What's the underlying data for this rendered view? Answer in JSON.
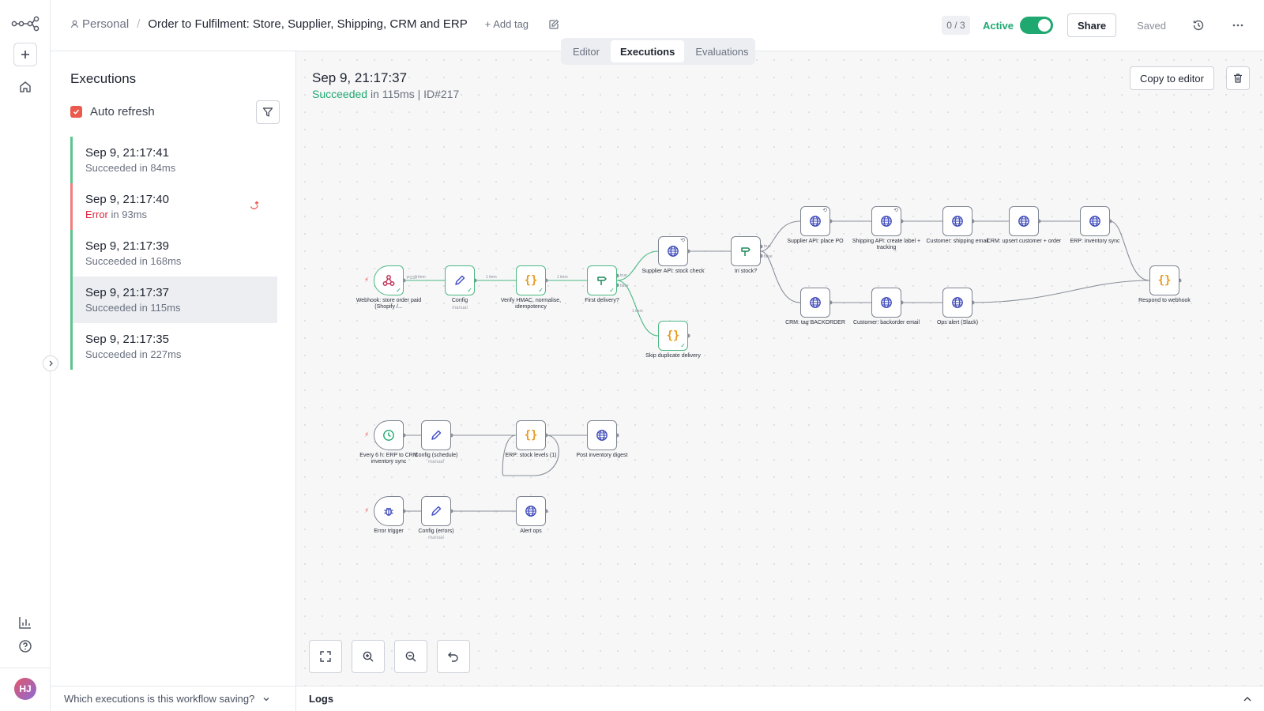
{
  "header": {
    "workspace": "Personal",
    "workflow_title": "Order to Fulfilment: Store, Supplier, Shipping, CRM and ERP",
    "add_tag": "+ Add tag",
    "counter": "0 / 3",
    "active_label": "Active",
    "share_label": "Share",
    "saved_label": "Saved"
  },
  "tabs": [
    "Editor",
    "Executions",
    "Evaluations"
  ],
  "executions": {
    "heading": "Executions",
    "auto_refresh_label": "Auto refresh",
    "items": [
      {
        "time": "Sep 9, 21:17:41",
        "state": "Succeeded",
        "duration": " in 84ms"
      },
      {
        "time": "Sep 9, 21:17:40",
        "state": "Error",
        "duration": " in 93ms"
      },
      {
        "time": "Sep 9, 21:17:39",
        "state": "Succeeded",
        "duration": " in 168ms"
      },
      {
        "time": "Sep 9, 21:17:37",
        "state": "Succeeded",
        "duration": " in 115ms"
      },
      {
        "time": "Sep 9, 21:17:35",
        "state": "Succeeded",
        "duration": " in 227ms"
      }
    ],
    "saving_question": "Which executions is this workflow saving?"
  },
  "run": {
    "time": "Sep 9, 21:17:37",
    "state": "Succeeded",
    "detail": " in 115ms | ID#217",
    "copy_label": "Copy to editor"
  },
  "nodes": {
    "webhook": "Webhook: store order paid (Shopify /...",
    "config": "Config",
    "config_sub": "manual",
    "verify": "Verify HMAC, normalise, idempotency",
    "first_delivery": "First delivery?",
    "supplier_stock": "Supplier API: stock check",
    "skip_dup": "Skip duplicate delivery",
    "in_stock": "In stock?",
    "supplier_po": "Supplier API: place PO",
    "shipping_label": "Shipping API: create label + tracking",
    "customer_shipping": "Customer: shipping email",
    "crm_upsert": "CRM: upsert customer + order",
    "erp_sync": "ERP: inventory sync",
    "respond": "Respond to webhook",
    "crm_backorder": "CRM: tag BACKORDER",
    "customer_backorder": "Customer: backorder email",
    "ops_alert": "Ops alert (Slack)",
    "every6h": "Every 6 h: ERP to CRM inventory sync",
    "config_schedule": "Config (schedule)",
    "config_schedule_sub": "manual",
    "erp_stock": "ERP: stock levels (1)",
    "post_digest": "Post inventory digest",
    "error_trigger": "Error trigger",
    "config_errors": "Config (errors)",
    "config_errors_sub": "manual",
    "alert_ops": "Alert ops"
  },
  "edge_labels": {
    "one_item": "1 item",
    "true": "true",
    "false": "false",
    "post": "POST"
  },
  "logs_label": "Logs",
  "colors": {
    "accent": "#ea5a4e",
    "success": "#1fa971",
    "error": "#e0243c"
  }
}
